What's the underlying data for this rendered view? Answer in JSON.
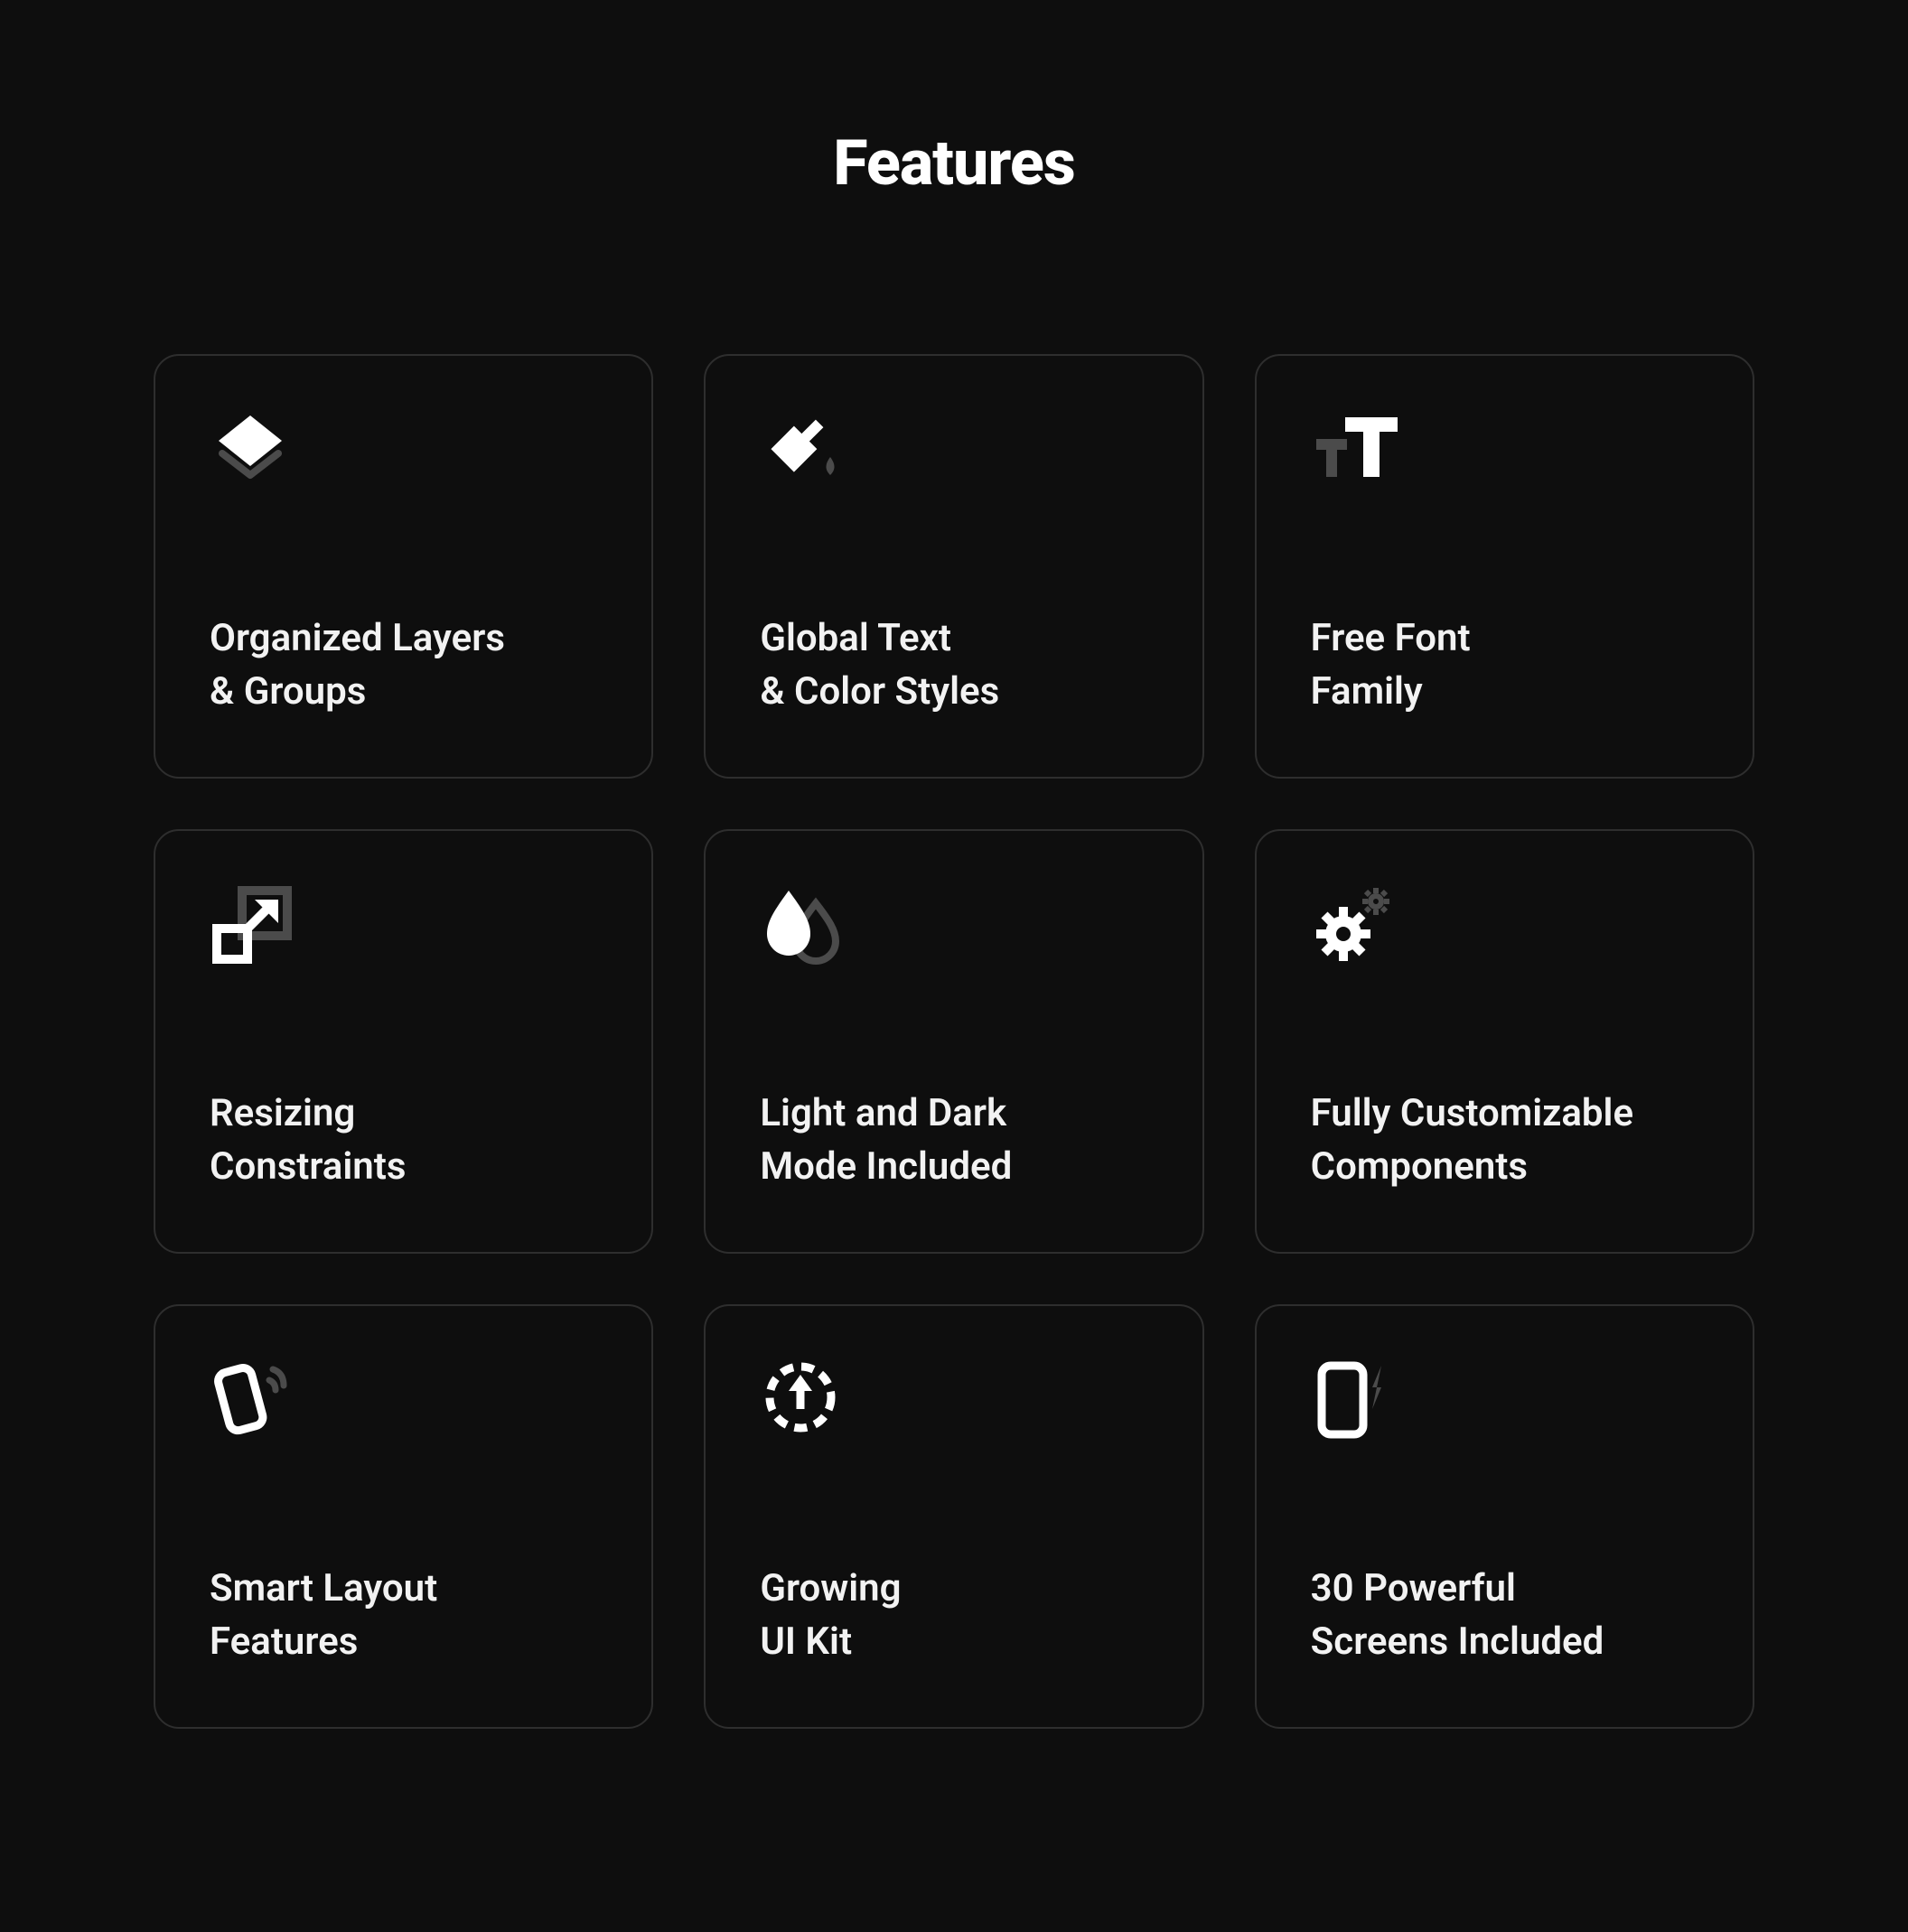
{
  "title": "Features",
  "cards": [
    {
      "icon": "layers-icon",
      "line1": "Organized Layers",
      "line2": "& Groups"
    },
    {
      "icon": "paint-icon",
      "line1": "Global Text",
      "line2": "& Color Styles"
    },
    {
      "icon": "text-size-icon",
      "line1": "Free Font",
      "line2": "Family"
    },
    {
      "icon": "resize-icon",
      "line1": "Resizing",
      "line2": "Constraints"
    },
    {
      "icon": "drops-icon",
      "line1": "Light and Dark",
      "line2": "Mode Included"
    },
    {
      "icon": "gears-icon",
      "line1": "Fully Customizable",
      "line2": "Components"
    },
    {
      "icon": "smart-icon",
      "line1": "Smart Layout",
      "line2": "Features"
    },
    {
      "icon": "update-icon",
      "line1": "Growing",
      "line2": "UI Kit"
    },
    {
      "icon": "screens-icon",
      "line1": "30 Powerful",
      "line2": "Screens Included"
    }
  ]
}
